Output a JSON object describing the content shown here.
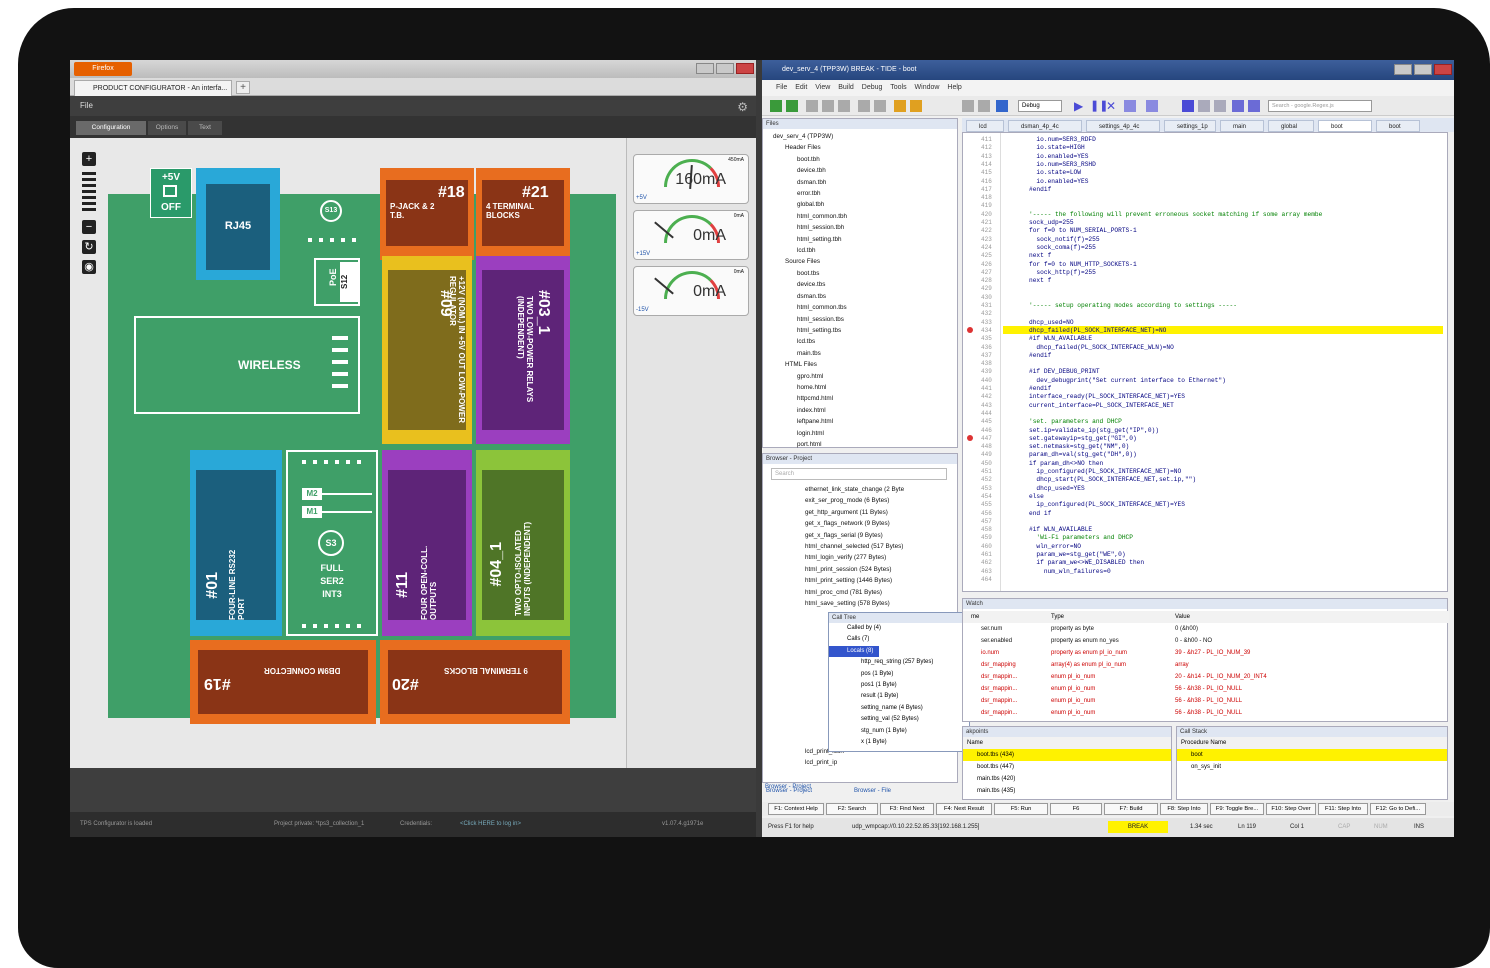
{
  "left": {
    "browser_button": "Firefox",
    "tab_title": "PRODUCT CONFIGURATOR - An interfa...",
    "tab_plus": "+",
    "menu_file": "File",
    "tabs": [
      "Configuration",
      "Options",
      "Text"
    ],
    "board": {
      "power_top": "+5V",
      "power_bottom": "OFF",
      "rj45": "RJ45",
      "s13": "S13",
      "poe": "PoE",
      "s12": "S12",
      "wireless": "WIRELESS",
      "m18_num": "#18",
      "m18_desc": "P-JACK & 2 T.B.",
      "m21_num": "#21",
      "m21_desc": "4 TERMINAL BLOCKS",
      "m09_num": "#09",
      "m09_desc": "+12V (NOM.) IN +5V OUT LOW-POWER REGULATOR",
      "m03_num": "#03_1",
      "m03_desc": "TWO LOW-POWER RELAYS (INDEPENDENT)",
      "m01_num": "#01",
      "m01_desc": "FOUR-LINE RS232 PORT",
      "m2": "M2",
      "m1": "M1",
      "s3": "S3",
      "full": "FULL",
      "ser2": "SER2",
      "int3": "INT3",
      "m11_num": "#11",
      "m11_desc": "FOUR OPEN-COLL. OUTPUTS",
      "m04_num": "#04_1",
      "m04_desc": "TWO OPTO-ISOLATED INPUTS (INDEPENDENT)",
      "m19_num": "#19",
      "m19_desc": "DB9M CONNECTOR",
      "m20_num": "#20",
      "m20_desc": "9 TERMINAL BLOCKS"
    },
    "gauges": [
      {
        "value": "160mA",
        "rail": "+5V",
        "max": "450mA"
      },
      {
        "value": "0mA",
        "rail": "+15V",
        "max": "0mA"
      },
      {
        "value": "0mA",
        "rail": "-15V",
        "max": "0mA"
      }
    ],
    "status": {
      "loaded": "TPS Configurator is loaded",
      "project": "Project private: *tps3_collection_1",
      "credentials": "Credentials:",
      "login": "<Click HERE to log in>",
      "version": "v1.07.4.g1971e"
    }
  },
  "ide": {
    "title": "dev_serv_4 (TPP3W) BREAK - TIDE - boot",
    "menu": [
      "File",
      "Edit",
      "View",
      "Build",
      "Debug",
      "Tools",
      "Window",
      "Help"
    ],
    "config": "Debug",
    "search_placeholder": "Search - google.Regex.js",
    "tabs": [
      "lcd",
      "dsman_4p_4c",
      "settings_4p_4c",
      "settings_1p",
      "main",
      "global",
      "boot",
      "boot"
    ],
    "files_title": "Files",
    "project_root": "dev_serv_4 (TPP3W)",
    "header_files": "Header Files",
    "headers": [
      "boot.tbh",
      "device.tbh",
      "dsman.tbh",
      "error.tbh",
      "global.tbh",
      "html_common.tbh",
      "html_session.tbh",
      "html_setting.tbh",
      "lcd.tbh"
    ],
    "source_files": "Source Files",
    "sources": [
      "boot.tbs",
      "device.tbs",
      "dsman.tbs",
      "html_common.tbs",
      "html_session.tbs",
      "html_setting.tbs",
      "lcd.tbs",
      "main.tbs"
    ],
    "html_files": "HTML Files",
    "htmls": [
      "gpro.html",
      "home.html",
      "httpcmd.html",
      "index.html",
      "leftpane.html",
      "login.html",
      "port.html"
    ],
    "browser_title": "Browser - Project",
    "browser_search": "Search",
    "browser_items": [
      "ethernet_link_state_change (2 Byte",
      "exit_ser_prog_mode (6 Bytes)",
      "get_http_argument (11 Bytes)",
      "get_x_flags_network (9 Bytes)",
      "get_x_flags_serial (9 Bytes)",
      "html_channel_selected (517 Bytes)",
      "html_login_verify (277 Bytes)",
      "html_print_session (524 Bytes)",
      "html_print_setting (1446 Bytes)",
      "html_proc_cmd (781 Bytes)",
      "html_save_setting (578 Bytes)"
    ],
    "browser_items2": [
      "lcd_print_icon",
      "lcd_print_ip"
    ],
    "calltree_title": "Call Tree",
    "calltree": [
      "Called by (4)",
      "Calls (7)",
      "Locals (8)",
      "http_req_string (257 Bytes)",
      "pos (1 Byte)",
      "pos1 (1 Byte)",
      "result (1 Byte)",
      "setting_name (4 Bytes)",
      "setting_val (52 Bytes)",
      "stg_num (1 Byte)",
      "x (1 Byte)"
    ],
    "browser_tabs": [
      "Browser - Project",
      "Browser - File"
    ],
    "line_numbers": [
      "411",
      "412",
      "413",
      "414",
      "415",
      "416",
      "417",
      "418",
      "419",
      "420",
      "421",
      "422",
      "423",
      "424",
      "425",
      "426",
      "427",
      "428",
      "429",
      "430",
      "431",
      "432",
      "433",
      "434",
      "435",
      "436",
      "437",
      "438",
      "439",
      "440",
      "441",
      "442",
      "443",
      "444",
      "445",
      "446",
      "447",
      "448",
      "449",
      "450",
      "451",
      "452",
      "453",
      "454",
      "455",
      "456",
      "457",
      "458",
      "459",
      "460",
      "461",
      "462",
      "463",
      "464"
    ],
    "code_lines": [
      "  io.num=SER3_RDFD",
      "  io.state=HIGH",
      "  io.enabled=YES",
      "  io.num=SER3_RSHD",
      "  io.state=LOW",
      "  io.enabled=YES",
      "#endif",
      "",
      "",
      "'----- the following will prevent erroneous socket matching if some array membe",
      "sock_udp=255",
      "for f=0 to NUM_SERIAL_PORTS-1",
      "  sock_notif(f)=255",
      "  sock_coma(f)=255",
      "next f",
      "for f=0 to NUM_HTTP_SOCKETS-1",
      "  sock_http(f)=255",
      "next f",
      "",
      "",
      "'----- setup operating modes according to settings -----",
      "",
      "dhcp_used=NO",
      "dhcp_failed(PL_SOCK_INTERFACE_NET)=NO",
      "#if WLN_AVAILABLE",
      "  dhcp_failed(PL_SOCK_INTERFACE_WLN)=NO",
      "#endif",
      "",
      "#if DEV_DEBUG_PRINT",
      "  dev_debugprint(\"Set current interface to Ethernet\")",
      "#endif",
      "interface_ready(PL_SOCK_INTERFACE_NET)=YES",
      "current_interface=PL_SOCK_INTERFACE_NET",
      "",
      "'set. parameters and DHCP",
      "set.ip=validate_ip(stg_get(\"IP\",0))",
      "set.gatewayip=stg_get(\"GI\",0)",
      "set.netmask=stg_get(\"NM\",0)",
      "param_dh=val(stg_get(\"DH\",0))",
      "if param_dh<>NO then",
      "  ip_configured(PL_SOCK_INTERFACE_NET)=NO",
      "  dhcp_start(PL_SOCK_INTERFACE_NET,set.ip,\"\")",
      "  dhcp_used=YES",
      "else",
      "  ip_configured(PL_SOCK_INTERFACE_NET)=YES",
      "end if",
      "",
      "#if WLN_AVAILABLE",
      "  'Wi-Fi parameters and DHCP",
      "  wln_error=NO",
      "  param_we=stg_get(\"WE\",0)",
      "  if param_we<>WE_DISABLED then",
      "    num_wln_failures=0",
      ""
    ],
    "watch_title": "Watch",
    "watch_headers": [
      "me",
      "Type",
      "Value"
    ],
    "watch_rows": [
      {
        "name": "ser.num",
        "type": "property as byte",
        "value": "0 (&h00)",
        "color": "#111111"
      },
      {
        "name": "ser.enabled",
        "type": "property as enum no_yes",
        "value": "0 - &h00 - NO",
        "color": "#111111"
      },
      {
        "name": "io.num",
        "type": "property as enum pl_io_num",
        "value": "39 - &h27 - PL_IO_NUM_39",
        "color": "#cc0000"
      },
      {
        "name": "dsr_mapping",
        "type": "array(4) as enum pl_io_num",
        "value": "array",
        "color": "#cc0000"
      },
      {
        "name": "dsr_mappin...",
        "type": "enum pl_io_num",
        "value": "20 - &h14 - PL_IO_NUM_20_INT4",
        "color": "#cc0000"
      },
      {
        "name": "dsr_mappin...",
        "type": "enum pl_io_num",
        "value": "56 - &h38 - PL_IO_NULL",
        "color": "#cc0000"
      },
      {
        "name": "dsr_mappin...",
        "type": "enum pl_io_num",
        "value": "56 - &h38 - PL_IO_NULL",
        "color": "#cc0000"
      },
      {
        "name": "dsr_mappin...",
        "type": "enum pl_io_num",
        "value": "56 - &h38 - PL_IO_NULL",
        "color": "#cc0000"
      }
    ],
    "breakpoints_title": "akpoints",
    "bp_header": "Name",
    "breakpoints": [
      "boot.tbs (434)",
      "boot.tbs (447)",
      "main.tbs (420)",
      "main.tbs (435)"
    ],
    "callstack_title": "Call Stack",
    "cs_header": "Procedure Name",
    "callstack": [
      "boot",
      "on_sys_init"
    ],
    "fkeys": [
      "F1: Context Help",
      "F2: Search",
      "F3: Find Next",
      "F4: Next Result",
      "F5: Run",
      "F6",
      "F7: Build",
      "F8: Step Into",
      "F9: Toggle Bre...",
      "F10: Step Over",
      "F11: Step Into",
      "F12: Go to Defi..."
    ],
    "status": {
      "help": "Press F1 for help",
      "target": "udp_wmpcap://0.10.22.52.85.33[192.168.1.255]",
      "mode": "BREAK",
      "time": "1.34 sec",
      "line": "Ln 119",
      "col": "Col 1",
      "cap": "CAP",
      "num": "NUM",
      "ins": "INS"
    }
  }
}
